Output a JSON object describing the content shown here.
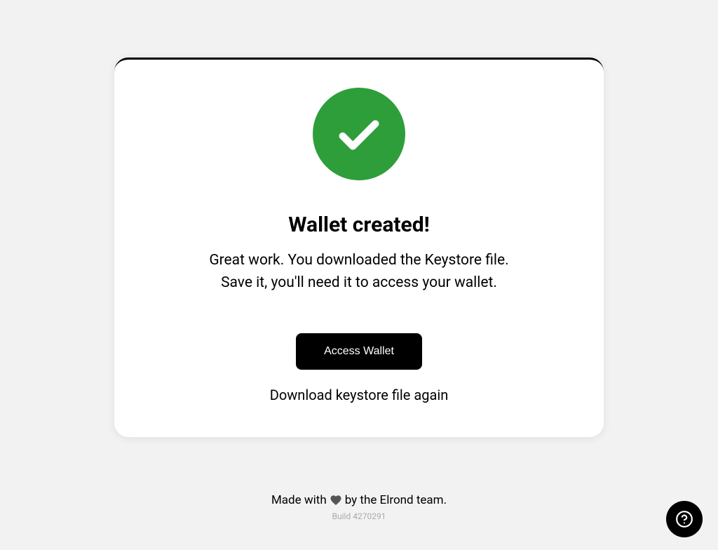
{
  "card": {
    "title": "Wallet created!",
    "subtitle_line1": "Great work. You downloaded the Keystore file.",
    "subtitle_line2": "Save it, you'll need it to access your wallet.",
    "primary_button_label": "Access Wallet",
    "secondary_link_label": "Download keystore file again"
  },
  "footer": {
    "prefix": "Made with",
    "suffix": "by the Elrond team.",
    "build_label": "Build 4270291"
  },
  "colors": {
    "success": "#2e9e3b",
    "heart": "#555555"
  }
}
